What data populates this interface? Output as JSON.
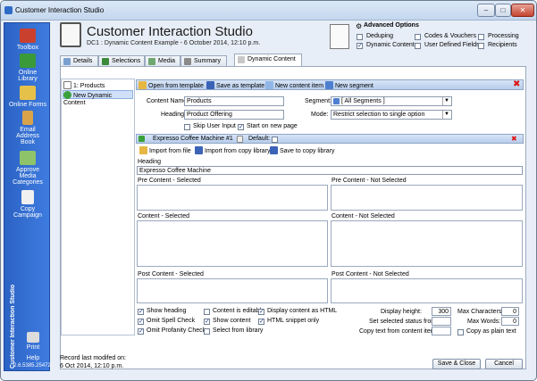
{
  "window": {
    "title": "Customer Interaction Studio",
    "min": "–",
    "max": "□",
    "close": "✕"
  },
  "sidebar": {
    "items": [
      {
        "label": "Toolbox",
        "icon": "toolbox-icon",
        "color": "#c9402e"
      },
      {
        "label": "Online Library",
        "icon": "online-library-icon",
        "color": "#3a9a3a"
      },
      {
        "label": "Online Forms",
        "icon": "online-forms-icon",
        "color": "#e6c14a"
      },
      {
        "label": "Email Address Book",
        "icon": "address-book-icon",
        "color": "#d9a34a"
      },
      {
        "label": "Approve Media Categories",
        "icon": "approve-media-icon",
        "color": "#8fc36a"
      },
      {
        "label": "Copy Campaign",
        "icon": "copy-campaign-icon",
        "color": "#f0f0f0"
      },
      {
        "label": "Print",
        "icon": "print-icon",
        "color": "#dcdcdc"
      },
      {
        "label": "Help",
        "icon": "help-icon",
        "color": "#ffffff"
      }
    ],
    "vertical_text": "Customer Interaction Studio",
    "version": "2.6.5385.25472"
  },
  "header": {
    "title": "Customer Interaction Studio",
    "subtitle": "DC1 : Dynamic Content Example - 6 October 2014, 12:10 p.m."
  },
  "advanced": {
    "title": "Advanced Options",
    "options": [
      {
        "label": "Deduping",
        "checked": false
      },
      {
        "label": "Codes & Vouchers",
        "checked": false
      },
      {
        "label": "Processing",
        "checked": false
      },
      {
        "label": "Dynamic Content",
        "checked": true
      },
      {
        "label": "User Defined Fields",
        "checked": false
      },
      {
        "label": "Recipients",
        "checked": false
      }
    ]
  },
  "tabs": [
    "Details",
    "Selections",
    "Media",
    "Summary",
    "Dynamic Content"
  ],
  "tree": {
    "items": [
      "1: Products",
      "New Dynamic Content"
    ]
  },
  "toolbar": {
    "open": "Open from template",
    "save": "Save as template",
    "new_item": "New content item",
    "new_segment": "New segment"
  },
  "form": {
    "content_name_label": "Content Name:",
    "content_name": "Products",
    "heading_label": "Heading:",
    "heading": "Product Offering",
    "segment_label": "Segment:",
    "segment": "[ All Segments ]",
    "mode_label": "Mode:",
    "mode": "Restrict selection to single option",
    "skip_label": "Skip User Input",
    "start_page_label": "Start on new page"
  },
  "item": {
    "title": "Expresso Coffee Machine #1",
    "default_label": "Default:",
    "import_file": "Import from file",
    "import_library": "Import from copy library",
    "save_library": "Save to copy library",
    "heading_label": "Heading",
    "heading_value": "Expresso Coffee Machine",
    "pre_selected": "Pre Content - Selected",
    "pre_not_selected": "Pre Content - Not Selected",
    "content_selected": "Content - Selected",
    "content_not_selected": "Content - Not Selected",
    "post_selected": "Post Content - Selected",
    "post_not_selected": "Post Content - Not Selected"
  },
  "options": {
    "col1": [
      {
        "label": "Show heading",
        "checked": true
      },
      {
        "label": "Omit Spell Check",
        "checked": true
      },
      {
        "label": "Omit Profanity Check",
        "checked": true
      }
    ],
    "col2": [
      {
        "label": "Content is editable",
        "checked": false
      },
      {
        "label": "Show content",
        "checked": true
      },
      {
        "label": "Select from library",
        "checked": false
      }
    ],
    "col3": [
      {
        "label": "Display content as HTML",
        "checked": true
      },
      {
        "label": "HTML snippet only",
        "checked": true
      }
    ],
    "display_height_label": "Display height:",
    "display_height": "300",
    "max_chars_label": "Max Characters:",
    "max_chars": "0",
    "set_status_label": "Set selected status from",
    "max_words_label": "Max Words:",
    "max_words": "0",
    "copy_text_label": "Copy text from content item:",
    "copy_plain_label": "Copy as plain text"
  },
  "status": {
    "line1": "Record last modifed on:",
    "line2": "6 Oct 2014, 12:10 p.m."
  },
  "buttons": {
    "save_close": "Save & Close",
    "cancel": "Cancel"
  }
}
